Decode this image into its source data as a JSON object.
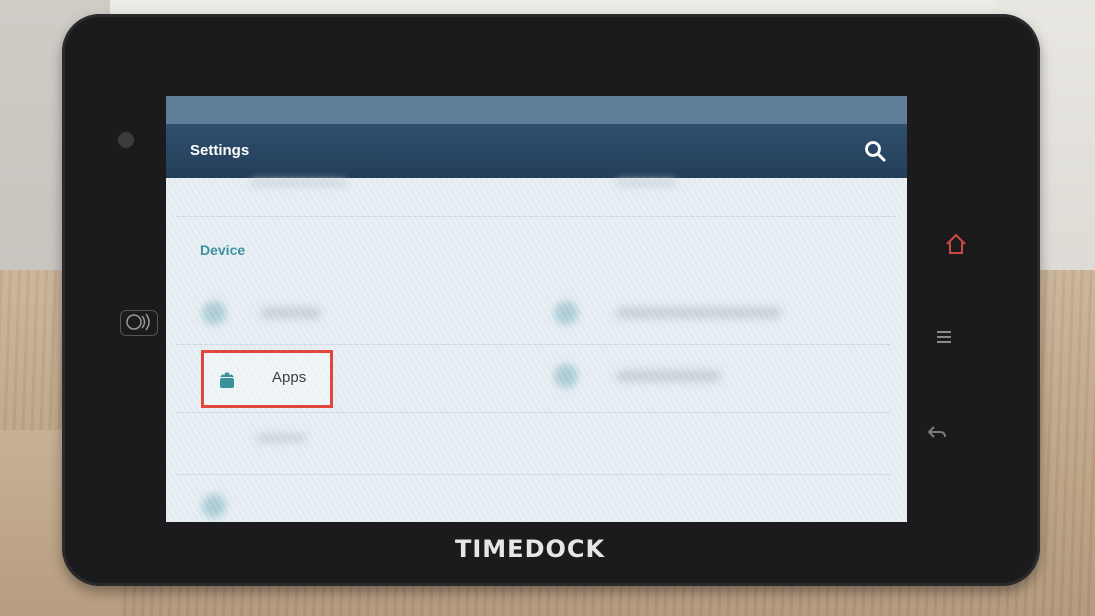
{
  "device": {
    "brand": "TIMEDOCK",
    "nav_icons": [
      "home-icon",
      "menu-icon",
      "back-icon"
    ]
  },
  "screen": {
    "action_bar": {
      "title": "Settings",
      "search_icon": "search-icon",
      "background_color": "#2f4f6e"
    },
    "category": {
      "title": "Device",
      "color": "#3a8f9c"
    },
    "highlighted_item": {
      "label": "Apps",
      "icon": "android-icon",
      "highlight_color": "#e2463d"
    }
  }
}
